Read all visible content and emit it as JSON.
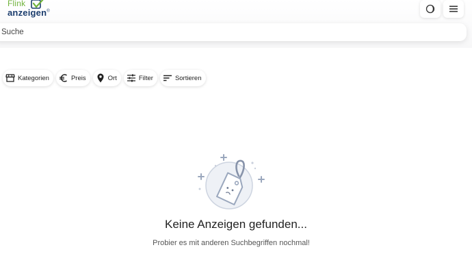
{
  "header": {
    "logo_line1": "Flink",
    "logo_line2": "anzeigen",
    "logo_mark": "®",
    "theme_toggle_icon": "half-moon-icon",
    "menu_icon": "hamburger-menu-icon"
  },
  "search": {
    "placeholder": "Suche",
    "value": ""
  },
  "filters": [
    {
      "label": "Kategorien",
      "icon": "store-icon"
    },
    {
      "label": "Preis",
      "icon": "euro-icon"
    },
    {
      "label": "Ort",
      "icon": "location-pin-icon"
    },
    {
      "label": "Filter",
      "icon": "sliders-icon"
    },
    {
      "label": "Sortieren",
      "icon": "sort-icon"
    }
  ],
  "empty_state": {
    "icon": "price-tag-icon",
    "title": "Keine Anzeigen gefunden...",
    "subtitle": "Probier es mit anderen Suchbegriffen nochmal!"
  },
  "colors": {
    "logo_green": "#6fb23a",
    "logo_blue": "#1b3d6d",
    "illustration": "#9aa7bd"
  }
}
